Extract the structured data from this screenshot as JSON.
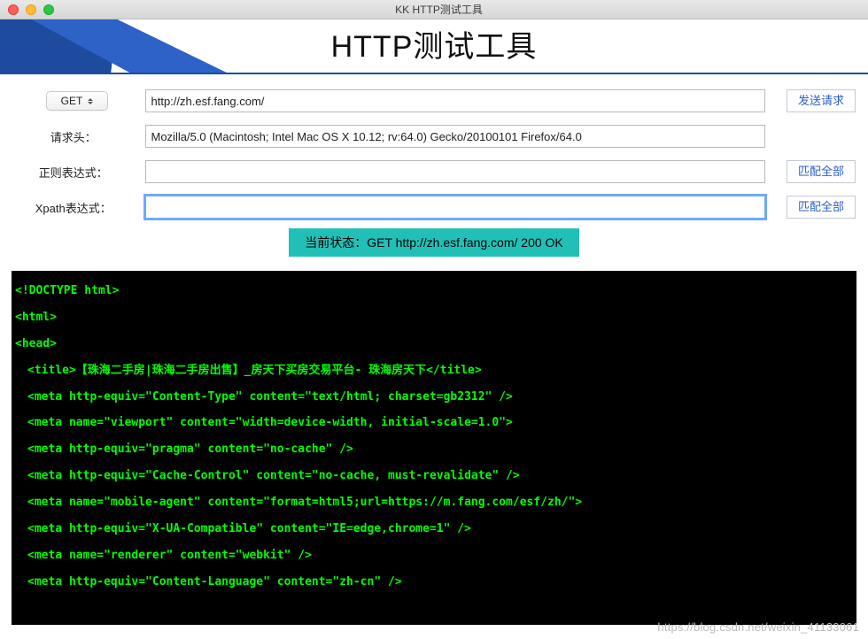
{
  "window": {
    "title": "KK HTTP测试工具"
  },
  "banner": {
    "title": "HTTP测试工具"
  },
  "form": {
    "method": "GET",
    "url": "http://zh.esf.fang.com/",
    "send_label": "发送请求",
    "headers_label": "请求头：",
    "headers_value": "Mozilla/5.0 (Macintosh; Intel Mac OS X 10.12; rv:64.0) Gecko/20100101 Firefox/64.0",
    "regex_label": "正则表达式：",
    "regex_value": "",
    "match_all_label": "匹配全部",
    "xpath_label": "Xpath表达式：",
    "xpath_value": ""
  },
  "status": {
    "text": "当前状态：GET http://zh.esf.fang.com/    200 OK"
  },
  "output": {
    "lines": [
      {
        "indent": 0,
        "text": "<!DOCTYPE html>"
      },
      {
        "indent": 0,
        "text": "<html>"
      },
      {
        "indent": 0,
        "text": "<head>"
      },
      {
        "indent": 1,
        "text": "<title>【珠海二手房|珠海二手房出售】_房天下买房交易平台- 珠海房天下</title>"
      },
      {
        "indent": 1,
        "text": "<meta http-equiv=\"Content-Type\" content=\"text/html; charset=gb2312\" />"
      },
      {
        "indent": 1,
        "text": "<meta name=\"viewport\" content=\"width=device-width, initial-scale=1.0\">"
      },
      {
        "indent": 1,
        "text": "<meta http-equiv=\"pragma\" content=\"no-cache\" />"
      },
      {
        "indent": 1,
        "text": "<meta http-equiv=\"Cache-Control\" content=\"no-cache,   must-revalidate\" />"
      },
      {
        "indent": 1,
        "text": "<meta name=\"mobile-agent\" content=\"format=html5;url=https://m.fang.com/esf/zh/\">"
      },
      {
        "indent": 1,
        "text": "<meta http-equiv=\"X-UA-Compatible\" content=\"IE=edge,chrome=1\" />"
      },
      {
        "indent": 1,
        "text": "<meta name=\"renderer\" content=\"webkit\" />"
      },
      {
        "indent": 1,
        "text": "<meta http-equiv=\"Content-Language\" content=\"zh-cn\" />"
      }
    ]
  },
  "watermark": "https://blog.csdn.net/weixin_41133061"
}
